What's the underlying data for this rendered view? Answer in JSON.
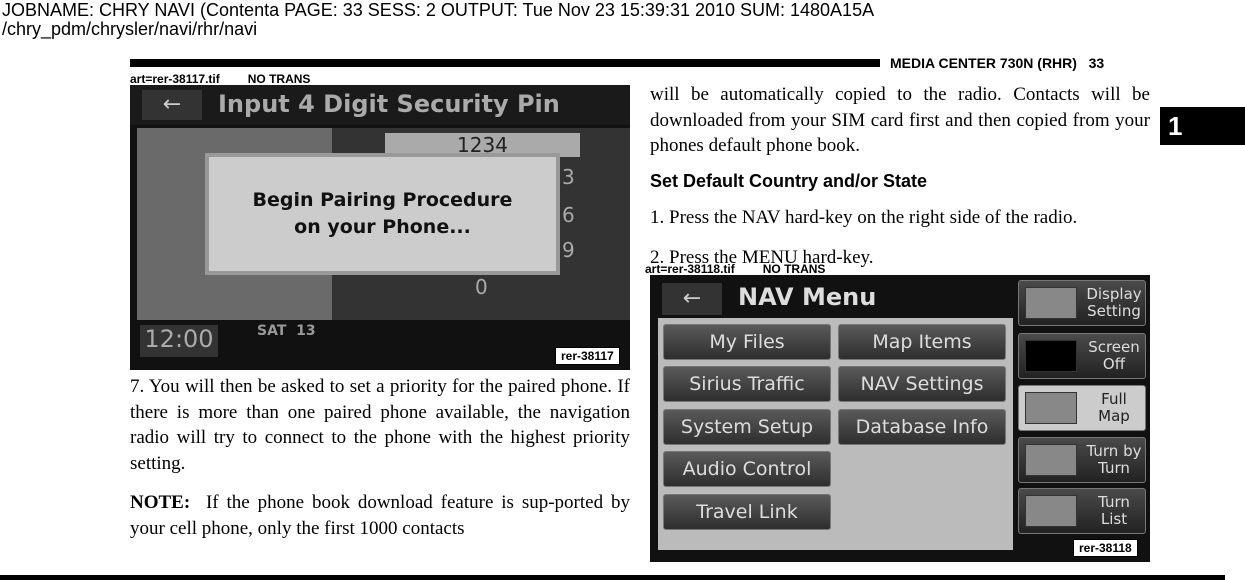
{
  "jobline": {
    "line1": "JOBNAME: CHRY NAVI (Contenta   PAGE: 33  SESS: 2  OUTPUT: Tue Nov 23 15:39:31 2010  SUM: 1480A15A",
    "line2": "/chry_pdm/chrysler/navi/rhr/navi"
  },
  "header": {
    "section": "MEDIA CENTER 730N (RHR)",
    "page": "33"
  },
  "tab": "1",
  "figure1": {
    "art": "art=rer-38117.tif",
    "trans": "NO TRANS",
    "title": "Input 4 Digit Security Pin",
    "pin": "1234",
    "keys": [
      "3",
      "6",
      "9",
      "0"
    ],
    "dialog_line1": "Begin Pairing Procedure",
    "dialog_line2": "on your Phone...",
    "clock": "12:00",
    "date": "SAT  13",
    "ref": "rer-38117"
  },
  "left_text": {
    "step7": "7.  You will then be asked to set a priority for the paired phone. If there is more than one paired phone available, the navigation radio will try to connect to the phone with the highest priority setting.",
    "note_label": "NOTE:",
    "note": "If the phone book download feature is sup-ported by your cell phone, only the first 1000 contacts"
  },
  "right_text": {
    "cont": "will be automatically copied to the radio. Contacts will be downloaded from your SIM card first and then copied from your phones default phone book.",
    "heading": "Set Default Country and/or State",
    "step1": "1.  Press the NAV hard-key on the right side of the radio.",
    "step2": "2.  Press the MENU hard-key."
  },
  "figure2": {
    "art": "art=rer-38118.tif",
    "trans": "NO TRANS",
    "title": "NAV Menu",
    "buttons": [
      "My Files",
      "Map Items",
      "Sirius Traffic",
      "NAV Settings",
      "System Setup",
      "Database Info",
      "Audio Control",
      "Travel Link"
    ],
    "side": [
      "Display Setting",
      "Screen Off",
      "Full Map",
      "Turn by Turn",
      "Turn List"
    ],
    "side_selected": "Full Map",
    "ref": "rer-38118"
  }
}
